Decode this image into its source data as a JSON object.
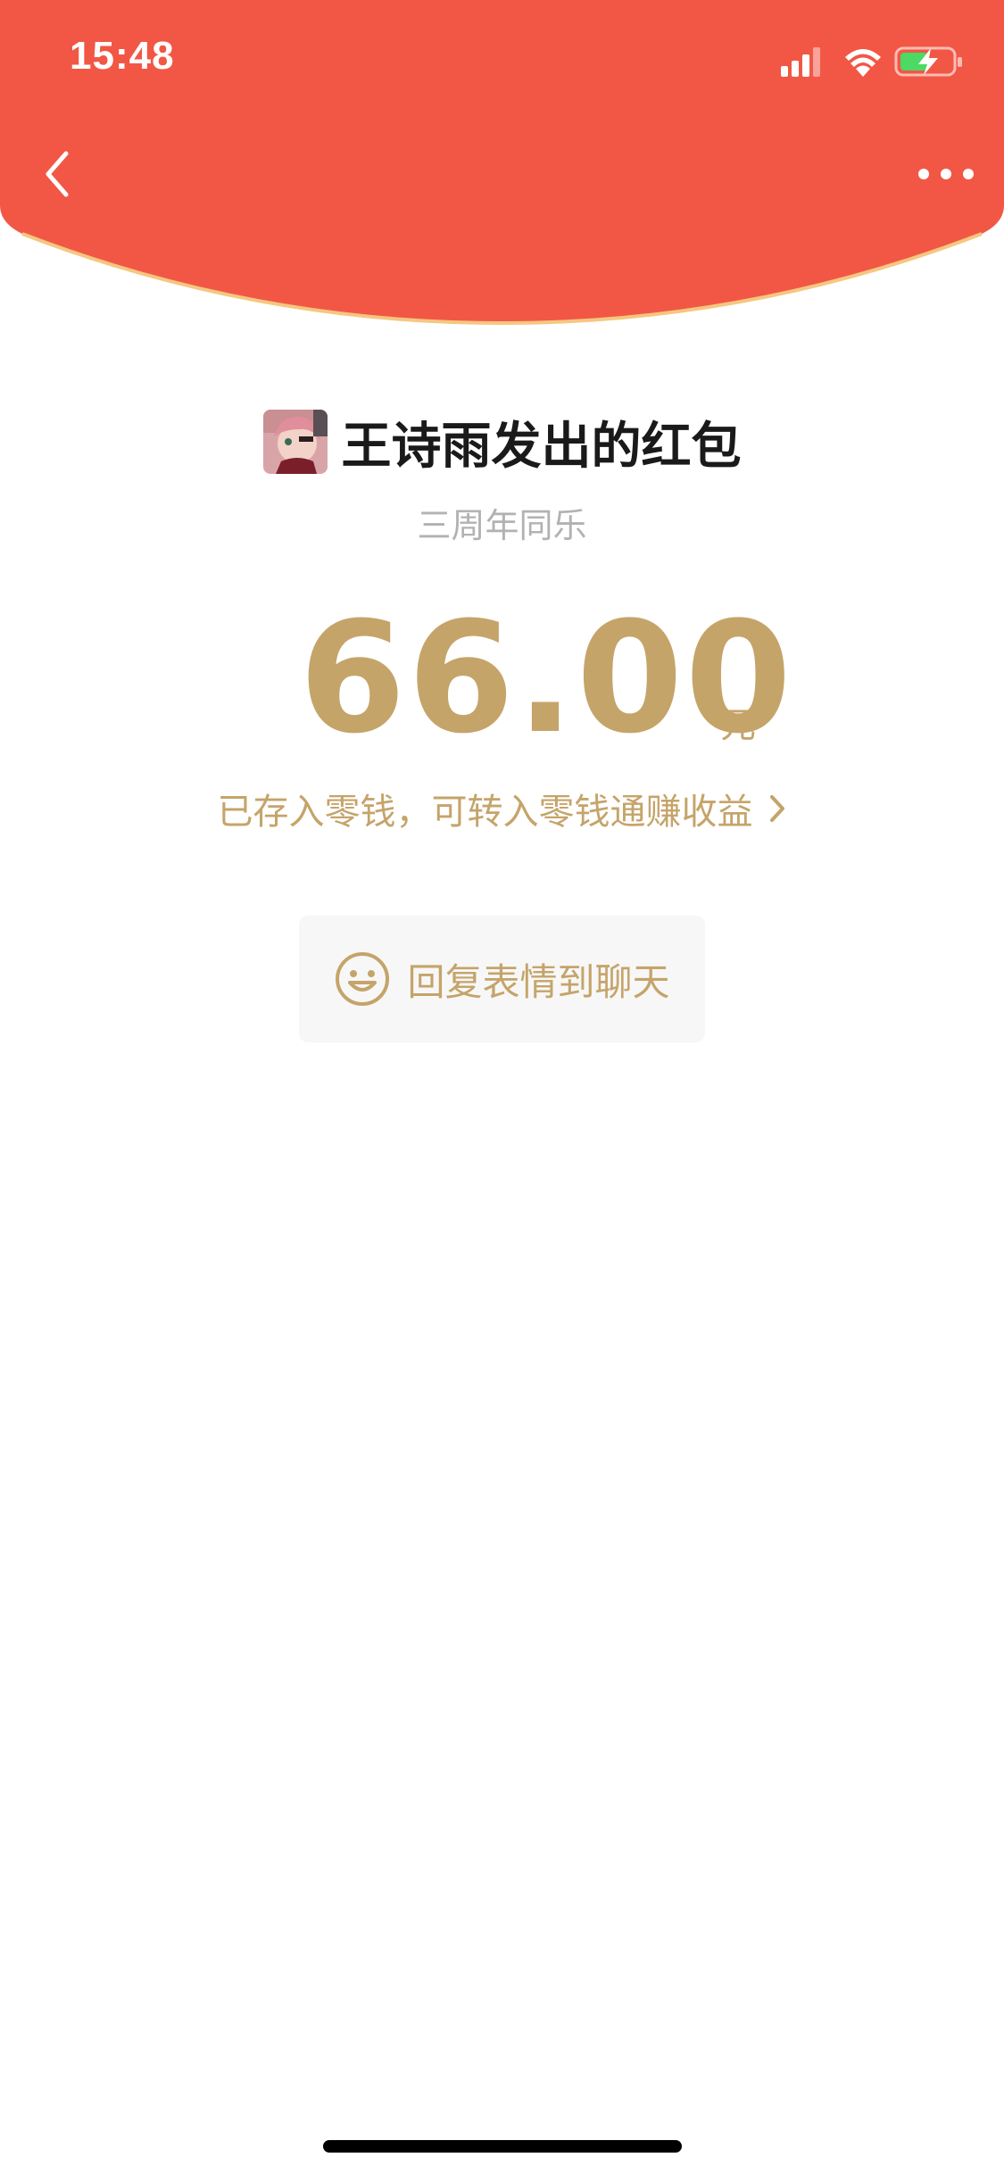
{
  "status_bar": {
    "time": "15:48"
  },
  "colors": {
    "header_red": "#f25745",
    "header_edge": "#f5c780",
    "gold": "#c5a46a",
    "gray_text": "#b2b2b2",
    "button_bg": "#f7f7f7"
  },
  "nav": {
    "back_icon": "chevron-left-icon",
    "more_icon": "more-dots-icon"
  },
  "envelope": {
    "sender_title": "王诗雨发出的红包",
    "greeting": "三周年同乐",
    "amount": "66.00",
    "currency": "元",
    "saved_text": "已存入零钱，可转入零钱通赚收益"
  },
  "reply": {
    "icon": "smiley-icon",
    "label": "回复表情到聊天"
  }
}
